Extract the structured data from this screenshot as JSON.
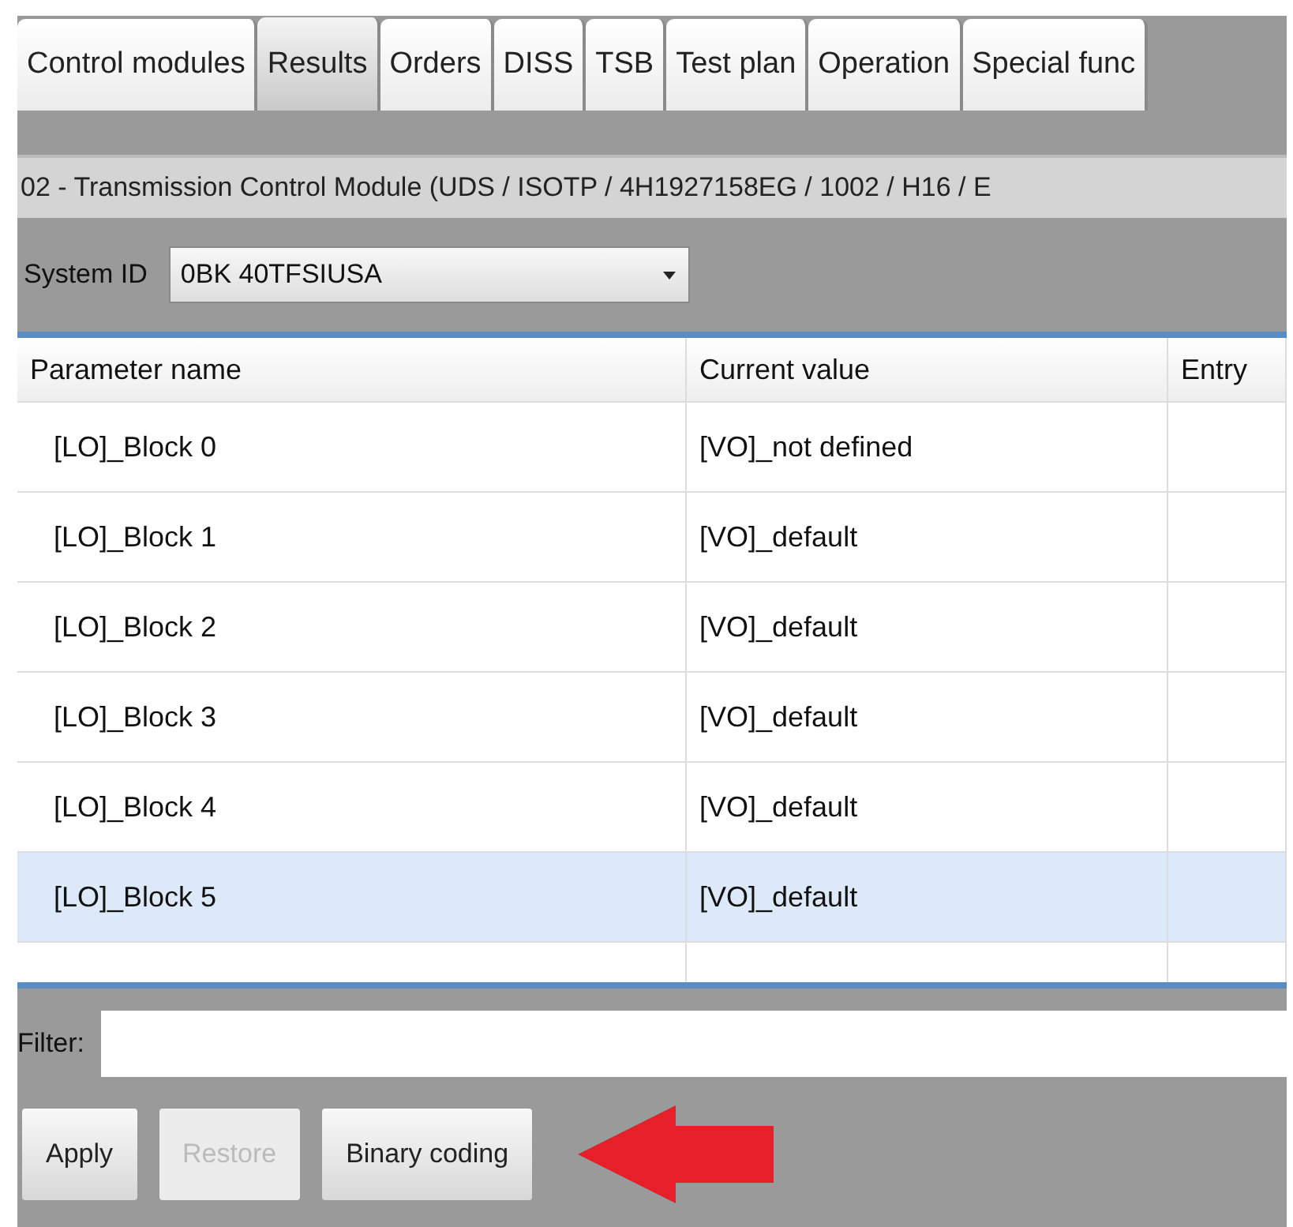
{
  "tabs": [
    {
      "label": "Control modules",
      "selected": false
    },
    {
      "label": "Results",
      "selected": true
    },
    {
      "label": "Orders",
      "selected": false
    },
    {
      "label": "DISS",
      "selected": false
    },
    {
      "label": "TSB",
      "selected": false
    },
    {
      "label": "Test plan",
      "selected": false
    },
    {
      "label": "Operation",
      "selected": false
    },
    {
      "label": "Special func",
      "selected": false
    }
  ],
  "module_title": "02 - Transmission Control Module  (UDS / ISOTP / 4H1927158EG / 1002 / H16 / E",
  "system_id": {
    "label": "System ID",
    "value": "0BK 40TFSIUSA"
  },
  "table": {
    "columns": [
      "Parameter name",
      "Current value",
      "Entry"
    ],
    "rows": [
      {
        "name": "[LO]_Block 0",
        "value": "[VO]_not defined",
        "selected": false
      },
      {
        "name": "[LO]_Block 1",
        "value": "[VO]_default",
        "selected": false
      },
      {
        "name": "[LO]_Block 2",
        "value": "[VO]_default",
        "selected": false
      },
      {
        "name": "[LO]_Block 3",
        "value": "[VO]_default",
        "selected": false
      },
      {
        "name": "[LO]_Block 4",
        "value": "[VO]_default",
        "selected": false
      },
      {
        "name": "[LO]_Block 5",
        "value": "[VO]_default",
        "selected": true
      }
    ]
  },
  "filter": {
    "label": "Filter:"
  },
  "buttons": [
    {
      "label": "Apply",
      "disabled": false
    },
    {
      "label": "Restore",
      "disabled": true
    },
    {
      "label": "Binary coding",
      "disabled": false
    }
  ],
  "callout_arrow": true
}
